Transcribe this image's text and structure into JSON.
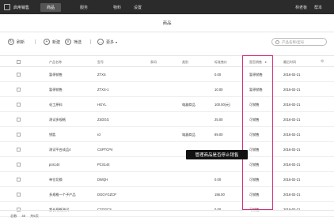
{
  "app": {
    "name": "启用销售"
  },
  "nav": {
    "tabs": [
      "商品",
      "服务",
      "物料",
      "设置"
    ],
    "active": 0
  },
  "user": {
    "name": "林老板",
    "help": "帮本"
  },
  "page": {
    "title": "商品"
  },
  "toolbar": {
    "refresh": "刷新",
    "add": "新建",
    "filter": "筛选",
    "more": "更多",
    "more_arrow": "▾"
  },
  "search": {
    "placeholder": "产品名称/型号"
  },
  "table": {
    "columns": [
      "产品名称",
      "型号",
      "条码",
      "类别",
      "标准售价",
      "是否销售",
      "最后时间"
    ],
    "rows": [
      {
        "name": "暂停销售",
        "code": "ZTXS",
        "barcode": "",
        "category": "",
        "price": "0.00",
        "status": "暂停销售",
        "date": "2016-02-21"
      },
      {
        "name": "暂停销售",
        "code": "ZTXS-1",
        "barcode": "",
        "category": "",
        "price": "10.00",
        "status": "暂停销售",
        "date": "2016-02-21"
      },
      {
        "name": "化工原料",
        "code": "HGYL",
        "barcode": "",
        "category": "电器商品",
        "price": "100.00(元)",
        "status": "可销售",
        "date": "2016-02-21"
      },
      {
        "name": "测试多规格",
        "code": "ZSDGG",
        "barcode": "",
        "category": "",
        "price": "25.00",
        "status": "可销售",
        "date": "2016-02-21"
      },
      {
        "name": "钥匙",
        "code": "rd",
        "barcode": "",
        "category": "电器商品",
        "price": "89.00",
        "status": "可销售",
        "date": "2016-02-21"
      },
      {
        "name": "测试平台成品4",
        "code": "CSPTCP4",
        "barcode": "",
        "category": "",
        "price": "",
        "status": "可销售",
        "date": "2016-02-21"
      },
      {
        "name": "pcs144",
        "code": "PCS144",
        "barcode": "",
        "category": "",
        "price": "",
        "status": "可销售",
        "date": "2016-02-21"
      },
      {
        "name": "单位切换",
        "code": "DWQH",
        "barcode": "",
        "category": "",
        "price": "0.00",
        "status": "可销售",
        "date": "2016-02-21"
      },
      {
        "name": "多规格一个子产品",
        "code": "DGGYGZCP",
        "barcode": "",
        "category": "",
        "price": "156.00",
        "status": "可销售",
        "date": "2016-02-21"
      },
      {
        "name": "超长规格测试",
        "code": "CZGGCS",
        "barcode": "",
        "category": "",
        "price": "0.00",
        "status": "可销售",
        "date": "2016-02-21"
      }
    ]
  },
  "tooltip": {
    "text": "管理商品是否停止销售"
  },
  "footer": {
    "total_label": "总数",
    "total": "40",
    "pages": "共5页"
  },
  "colors": {
    "topbar": "#2b2b2b",
    "highlight": "#d4307a",
    "tooltip": "#111111"
  }
}
